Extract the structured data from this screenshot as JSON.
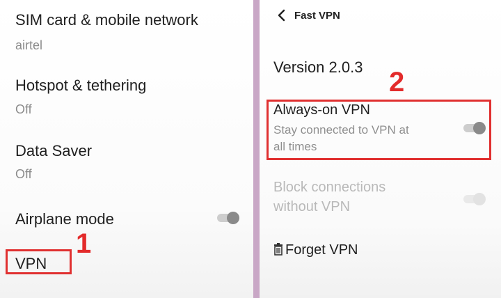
{
  "left_panel": {
    "sim": {
      "title": "SIM card & mobile network",
      "subtitle": "airtel"
    },
    "hotspot": {
      "title": "Hotspot & tethering",
      "subtitle": "Off"
    },
    "data_saver": {
      "title": "Data Saver",
      "subtitle": "Off"
    },
    "airplane": {
      "title": "Airplane mode",
      "enabled": false
    },
    "vpn": {
      "title": "VPN"
    },
    "step_label": "1"
  },
  "right_panel": {
    "header": {
      "title": "Fast VPN",
      "back_icon": "chevron-left-icon"
    },
    "version": "Version 2.0.3",
    "step_label": "2",
    "always_on": {
      "title": "Always-on VPN",
      "subtitle_line1": "Stay connected to VPN at",
      "subtitle_line2": "all times",
      "enabled": false
    },
    "block": {
      "title_line1": "Block connections",
      "title_line2": "without VPN",
      "enabled": false,
      "disabled": true
    },
    "forget": {
      "label": "Forget VPN",
      "icon": "trash-icon"
    }
  },
  "colors": {
    "highlight": "#e03030",
    "divider": "#c9a7c6"
  }
}
